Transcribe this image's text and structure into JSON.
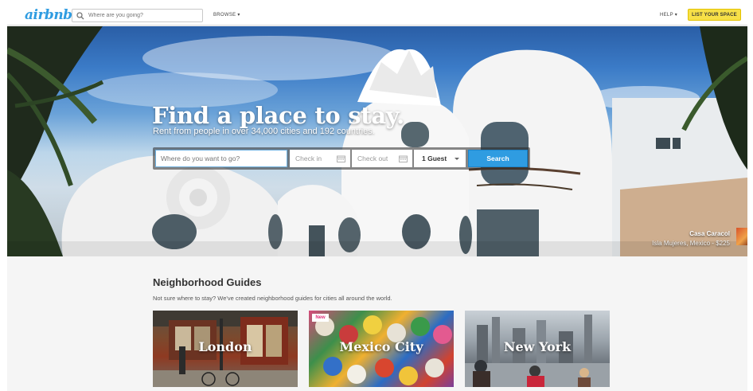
{
  "header": {
    "logo_text": "airbnb",
    "search_placeholder": "Where are you going?",
    "browse_label": "BROWSE ▾",
    "help_label": "HELP ▾",
    "list_space_label": "LIST YOUR SPACE"
  },
  "hero": {
    "title": "Find a place to stay.",
    "subtitle": "Rent from people in over 34,000 cities and 192 countries.",
    "search": {
      "where_placeholder": "Where do you want to go?",
      "checkin_placeholder": "Check in",
      "checkout_placeholder": "Check out",
      "guests_value": "1 Guest",
      "search_label": "Search"
    },
    "caption": {
      "title": "Casa Caracol",
      "subtitle": "Isla Mujeres, Mexico - $225"
    }
  },
  "guides": {
    "title": "Neighborhood Guides",
    "description": "Not sure where to stay? We've created neighborhood guides for cities all around the world.",
    "tiles": [
      {
        "label": "London",
        "badge": ""
      },
      {
        "label": "Mexico City",
        "badge": "New"
      },
      {
        "label": "New York",
        "badge": ""
      }
    ]
  },
  "colors": {
    "brand_blue": "#2f9ce1",
    "list_space_yellow": "#f7e047"
  }
}
